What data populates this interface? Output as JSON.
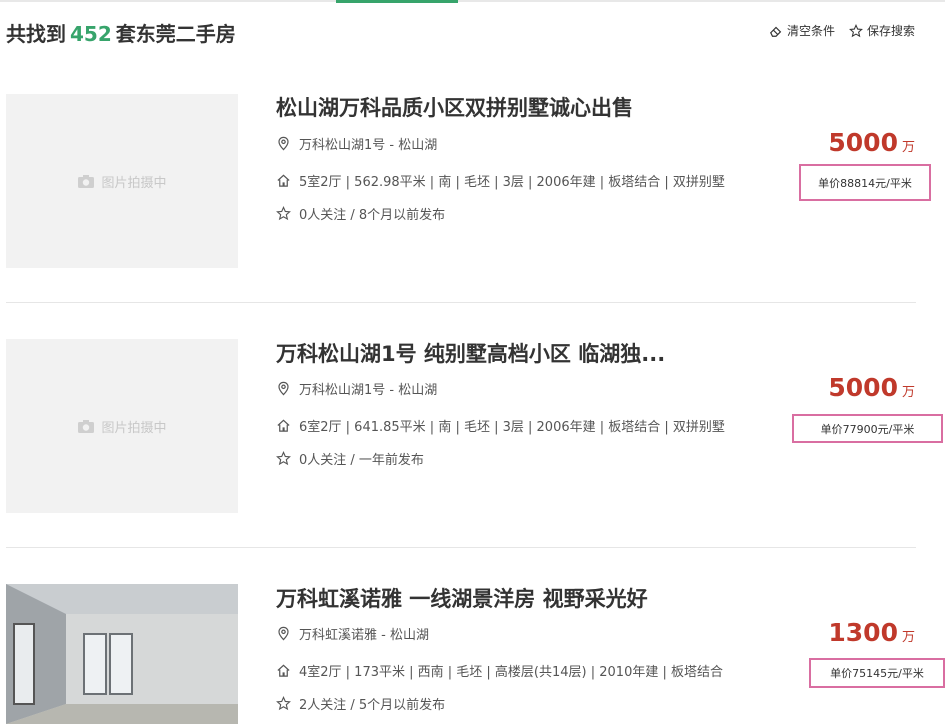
{
  "summary": {
    "prefix": "共找到",
    "count": "452",
    "suffix": "套东莞二手房"
  },
  "toolbar": {
    "clear_label": "清空条件",
    "save_label": "保存搜索"
  },
  "listings": [
    {
      "thumb_text": "图片拍摄中",
      "title": "松山湖万科品质小区双拼别墅诚心出售",
      "location": "万科松山湖1号 - 松山湖",
      "details": "5室2厅 | 562.98平米 | 南 | 毛坯 | 3层 | 2006年建 | 板塔结合 | 双拼别墅",
      "follow": "0人关注 / 8个月以前发布",
      "price": "5000",
      "price_unit": "万",
      "unit_price": "单价88814元/平米"
    },
    {
      "thumb_text": "图片拍摄中",
      "title": "万科松山湖1号 纯别墅高档小区 临湖独...",
      "location": "万科松山湖1号 - 松山湖",
      "details": "6室2厅 | 641.85平米 | 南 | 毛坯 | 3层 | 2006年建 | 板塔结合 | 双拼别墅",
      "follow": "0人关注 / 一年前发布",
      "price": "5000",
      "price_unit": "万",
      "unit_price": "单价77900元/平米"
    },
    {
      "thumb_text": "",
      "title": "万科虹溪诺雅 一线湖景洋房 视野采光好",
      "location": "万科虹溪诺雅 - 松山湖",
      "details": "4室2厅 | 173平米 | 西南 | 毛坯 | 高楼层(共14层) | 2010年建 | 板塔结合",
      "follow": "2人关注 / 5个月以前发布",
      "price": "1300",
      "price_unit": "万",
      "unit_price": "单价75145元/平米"
    }
  ],
  "colors": {
    "accent_green": "#37a46b",
    "price_red": "#c0392b",
    "highlight_pink": "#d96ea1"
  }
}
